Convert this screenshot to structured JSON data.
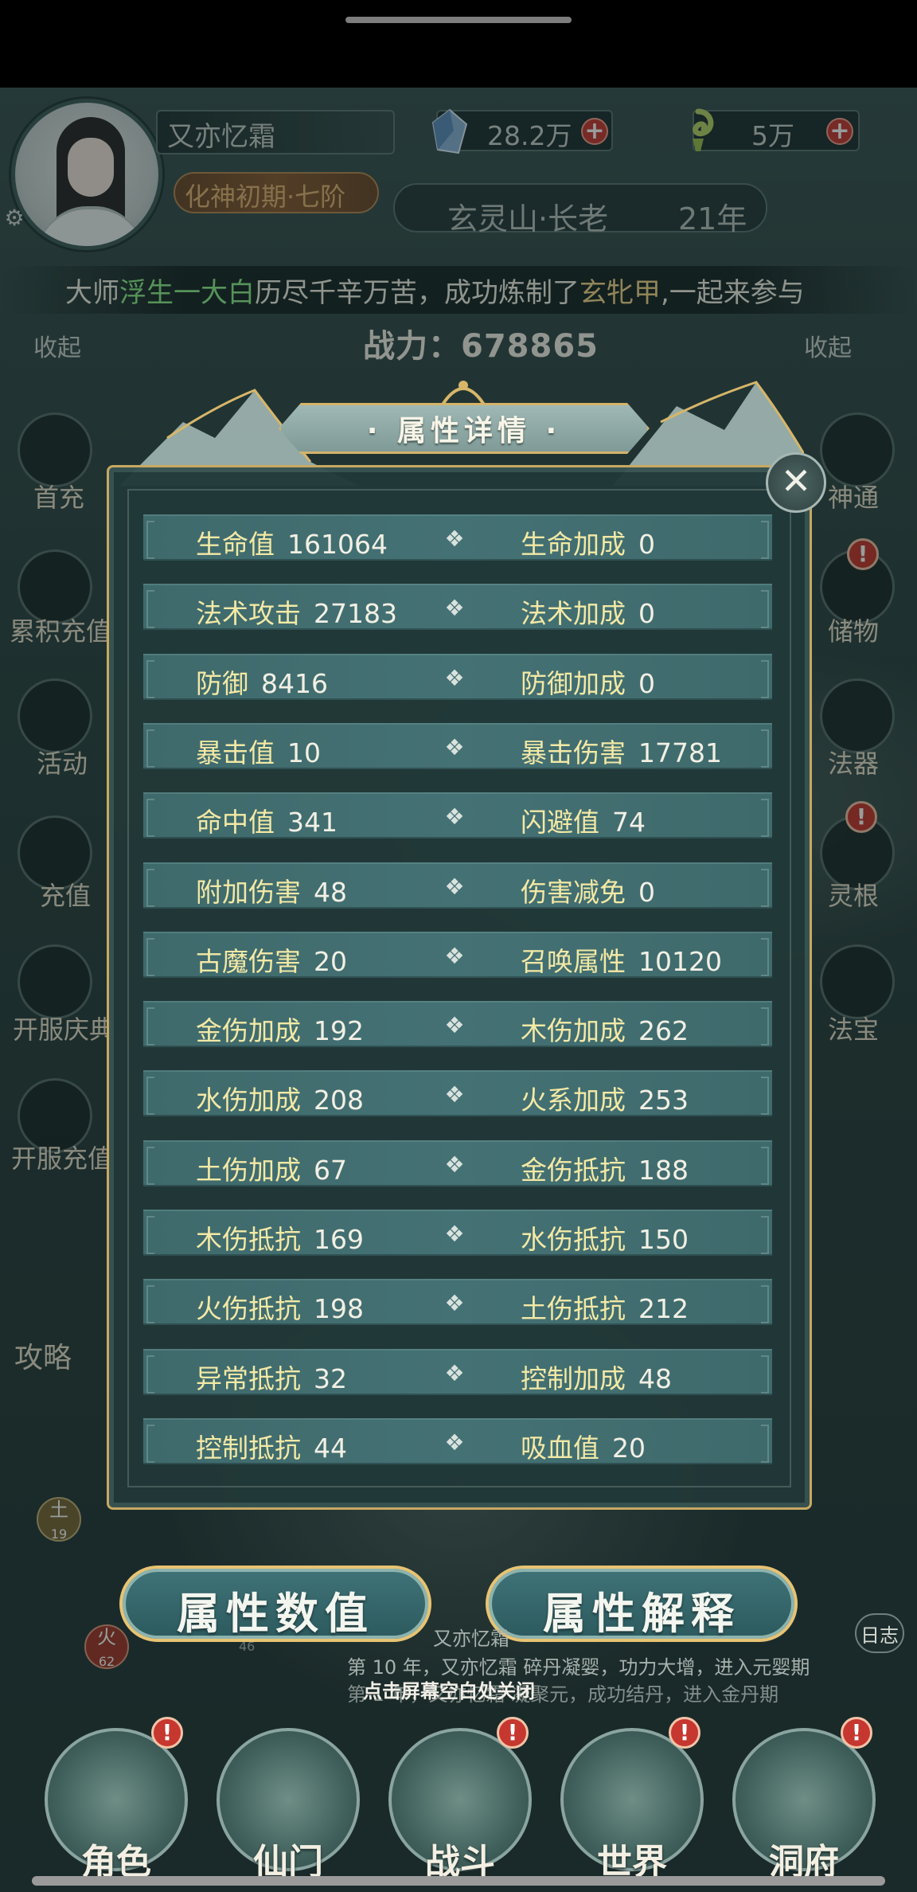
{
  "player": {
    "name": "又亦忆霜",
    "rank": "化神初期·七阶",
    "sect": "玄灵山·长老",
    "years": "21年",
    "crystals": "28.2万",
    "jade": "5万"
  },
  "ticker": {
    "part1": "大师",
    "name": "浮生一大白",
    "part2": "历尽千辛万苦，成功炼制了",
    "item": "玄牝甲",
    "part3": ",一起来参与"
  },
  "power": {
    "label": "战力：",
    "value": "678865"
  },
  "side": {
    "collapse_left": "收起",
    "collapse_right": "收起",
    "left_items": [
      "首充",
      "累积充值",
      "活动",
      "充值",
      "开服庆典",
      "开服充值"
    ],
    "right_items": [
      "神通",
      "储物",
      "法器",
      "灵根",
      "法宝"
    ],
    "guide": "攻略"
  },
  "panel": {
    "title": "· 属性详情 ·",
    "rows": [
      {
        "l_label": "生命值",
        "l_value": "161064",
        "r_label": "生命加成",
        "r_value": "0"
      },
      {
        "l_label": "法术攻击",
        "l_value": "27183",
        "r_label": "法术加成",
        "r_value": "0"
      },
      {
        "l_label": "防御",
        "l_value": "8416",
        "r_label": "防御加成",
        "r_value": "0"
      },
      {
        "l_label": "暴击值",
        "l_value": "10",
        "r_label": "暴击伤害",
        "r_value": "17781"
      },
      {
        "l_label": "命中值",
        "l_value": "341",
        "r_label": "闪避值",
        "r_value": "74"
      },
      {
        "l_label": "附加伤害",
        "l_value": "48",
        "r_label": "伤害减免",
        "r_value": "0"
      },
      {
        "l_label": "古魔伤害",
        "l_value": "20",
        "r_label": "召唤属性",
        "r_value": "10120"
      },
      {
        "l_label": "金伤加成",
        "l_value": "192",
        "r_label": "木伤加成",
        "r_value": "262"
      },
      {
        "l_label": "水伤加成",
        "l_value": "208",
        "r_label": "火系加成",
        "r_value": "253"
      },
      {
        "l_label": "土伤加成",
        "l_value": "67",
        "r_label": "金伤抵抗",
        "r_value": "188"
      },
      {
        "l_label": "木伤抵抗",
        "l_value": "169",
        "r_label": "水伤抵抗",
        "r_value": "150"
      },
      {
        "l_label": "火伤抵抗",
        "l_value": "198",
        "r_label": "土伤抵抗",
        "r_value": "212"
      },
      {
        "l_label": "异常抵抗",
        "l_value": "32",
        "r_label": "控制加成",
        "r_value": "48"
      },
      {
        "l_label": "控制抵抗",
        "l_value": "44",
        "r_label": "吸血值",
        "r_value": "20"
      }
    ],
    "diamond": "❖"
  },
  "buttons": {
    "values": "属性数值",
    "explain": "属性解释"
  },
  "log": {
    "line1": "第 10 年，又亦忆霜 碎丹凝婴，功力大增，进入元婴期",
    "line1_prefix": "又亦忆霜",
    "line2": "第 1 年，又亦忆霜 凝聚元，成功结丹，进入金丹期",
    "tap_hint": "点击屏幕空白处关闭",
    "log_button": "日志"
  },
  "elements": {
    "earth": "土",
    "earth_val": "19",
    "fire": "火",
    "fire_val": "62",
    "other_val": "46"
  },
  "nav": [
    "角色",
    "仙门",
    "战斗",
    "世界",
    "洞府"
  ],
  "badge_symbol": "!",
  "colors": {
    "panel_bg": "#213838",
    "gold": "#c8a862",
    "label_yellow": "#f3e9a5",
    "badge_red": "#c6372f"
  }
}
